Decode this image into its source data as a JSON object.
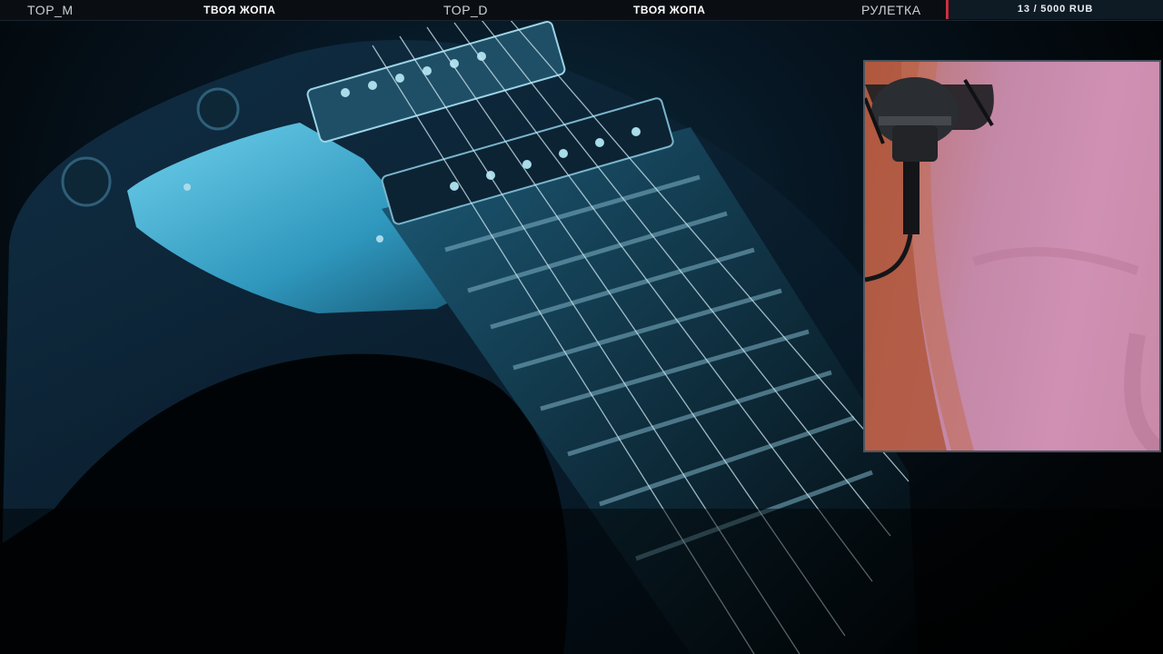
{
  "topbar": {
    "top_m_label": "TOP_M",
    "top_m_value": "ТВОЯ ЖОПА",
    "top_d_label": "TOP_D",
    "top_d_value": "ТВОЯ ЖОПА",
    "roulette_label": "РУЛЕТКА",
    "goal_text": "13 / 5000 RUB",
    "goal_progress": 0.0026
  },
  "colors": {
    "accent": "#c0283a",
    "bar_bg": "#0a0e12",
    "guitar_tint": "#3aa6c8"
  }
}
